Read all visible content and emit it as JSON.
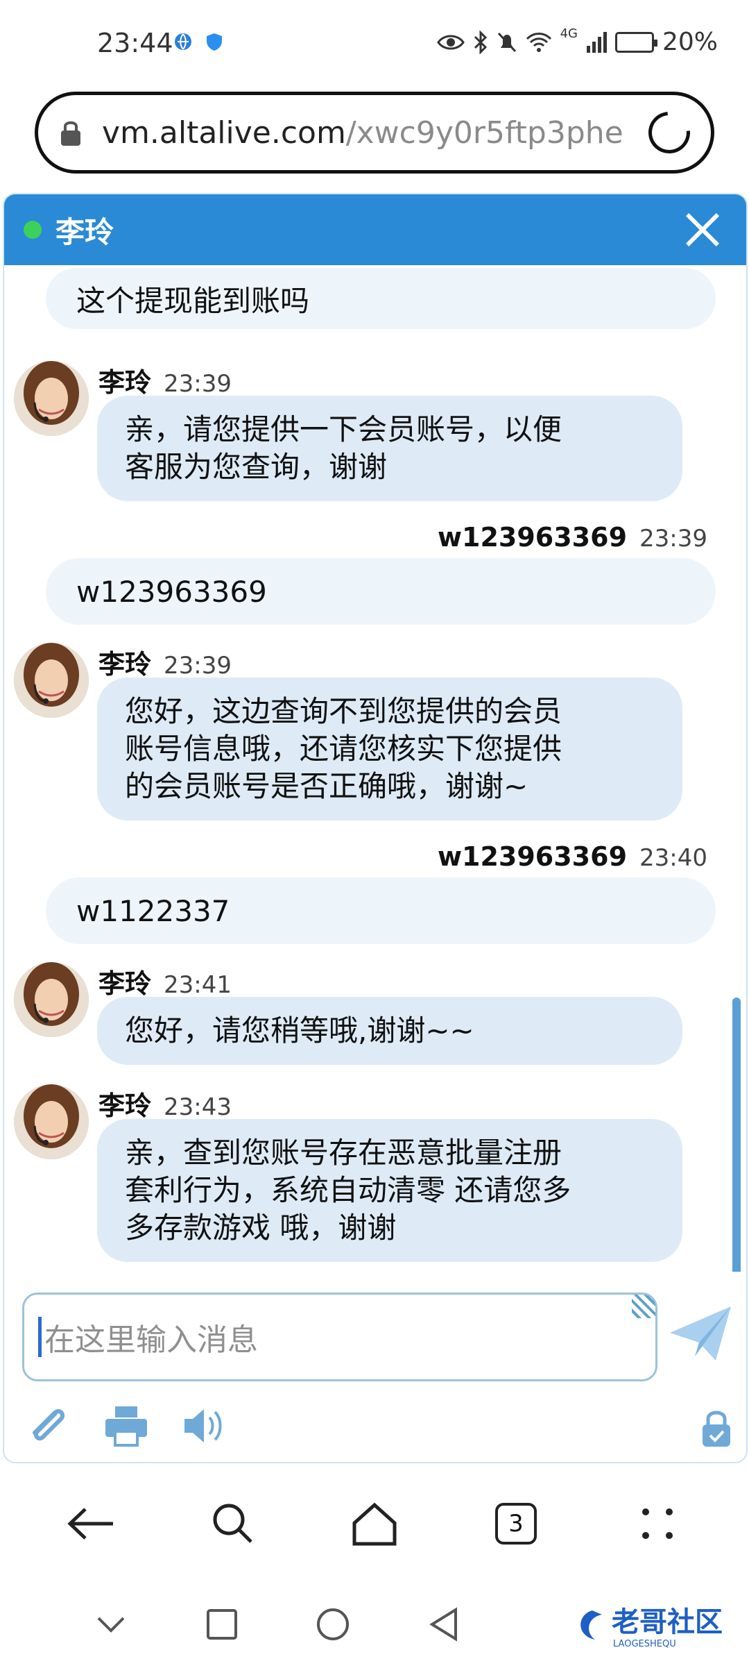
{
  "status_bar": {
    "time": "23:44",
    "battery": "20%",
    "network": "4G"
  },
  "url_bar": {
    "host": "vm.altalive.com",
    "path": "/xwc9y0r5ftp3phe"
  },
  "chat": {
    "agent_name": "李玲",
    "input_placeholder": "在这里输入消息",
    "messages": [
      {
        "type": "user",
        "text": "这个提现能到账吗"
      },
      {
        "type": "agent",
        "name": "李玲",
        "time": "23:39",
        "lines": [
          "亲，请您提供一下会员账号，以便",
          "客服为您查询，谢谢"
        ]
      },
      {
        "type": "user",
        "name": "w123963369",
        "time": "23:39",
        "text": "w123963369"
      },
      {
        "type": "agent",
        "name": "李玲",
        "time": "23:39",
        "lines": [
          "您好，这边查询不到您提供的会员",
          "账号信息哦，还请您核实下您提供",
          "的会员账号是否正确哦，谢谢~"
        ]
      },
      {
        "type": "user",
        "name": "w123963369",
        "time": "23:40",
        "text": "w1122337"
      },
      {
        "type": "agent",
        "name": "李玲",
        "time": "23:41",
        "lines": [
          "您好，请您稍等哦,谢谢~~"
        ]
      },
      {
        "type": "agent",
        "name": "李玲",
        "time": "23:43",
        "lines": [
          "亲，查到您账号存在恶意批量注册",
          "套利行为，系统自动清零  还请您多",
          "多存款游戏 哦，谢谢"
        ]
      }
    ]
  },
  "browser_nav": {
    "tab_count": "3"
  },
  "watermark": {
    "text": "老哥社区",
    "subtext": "LAOGESHEQU"
  },
  "colors": {
    "header_blue": "#2a8ad6",
    "agent_bubble": "#deebf7",
    "user_bubble": "#eef5fa",
    "online_green": "#3bd15b"
  }
}
